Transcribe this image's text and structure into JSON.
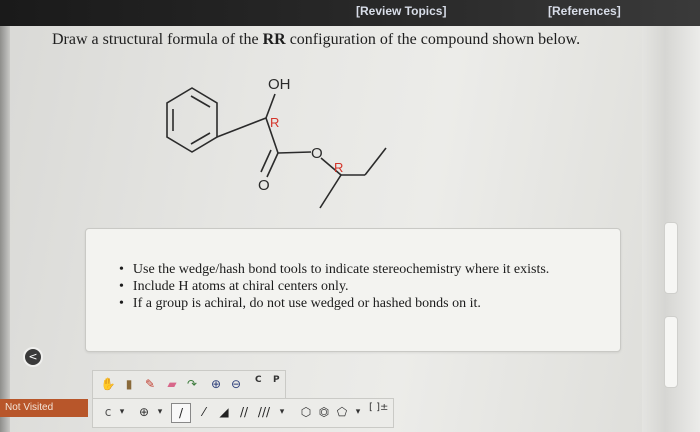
{
  "header": {
    "review_topics": "[Review Topics]",
    "references": "[References]"
  },
  "question": {
    "prefix": "Draw a structural formula of the ",
    "configuration": "RR",
    "suffix": " configuration of the compound shown below."
  },
  "molecule": {
    "hydroxyl_label": "OH",
    "stereo_label_1": "R",
    "ester_oxygen_label": "O",
    "carbonyl_oxygen_label": "O",
    "stereo_label_2": "R",
    "bond_color": "#2b2b2b",
    "stereo_label_color": "#d4342a"
  },
  "instructions": {
    "items": [
      "Use the wedge/hash bond tools to indicate stereochemistry where it exists.",
      "Include H atoms at chiral centers only.",
      "If a group is achiral, do not use wedged or hashed bonds on it."
    ]
  },
  "status": {
    "not_visited": "Not Visited"
  },
  "toolbar": {
    "tool_c_label": "C",
    "tool_p_label": "P",
    "template_label": "[ ]±"
  }
}
